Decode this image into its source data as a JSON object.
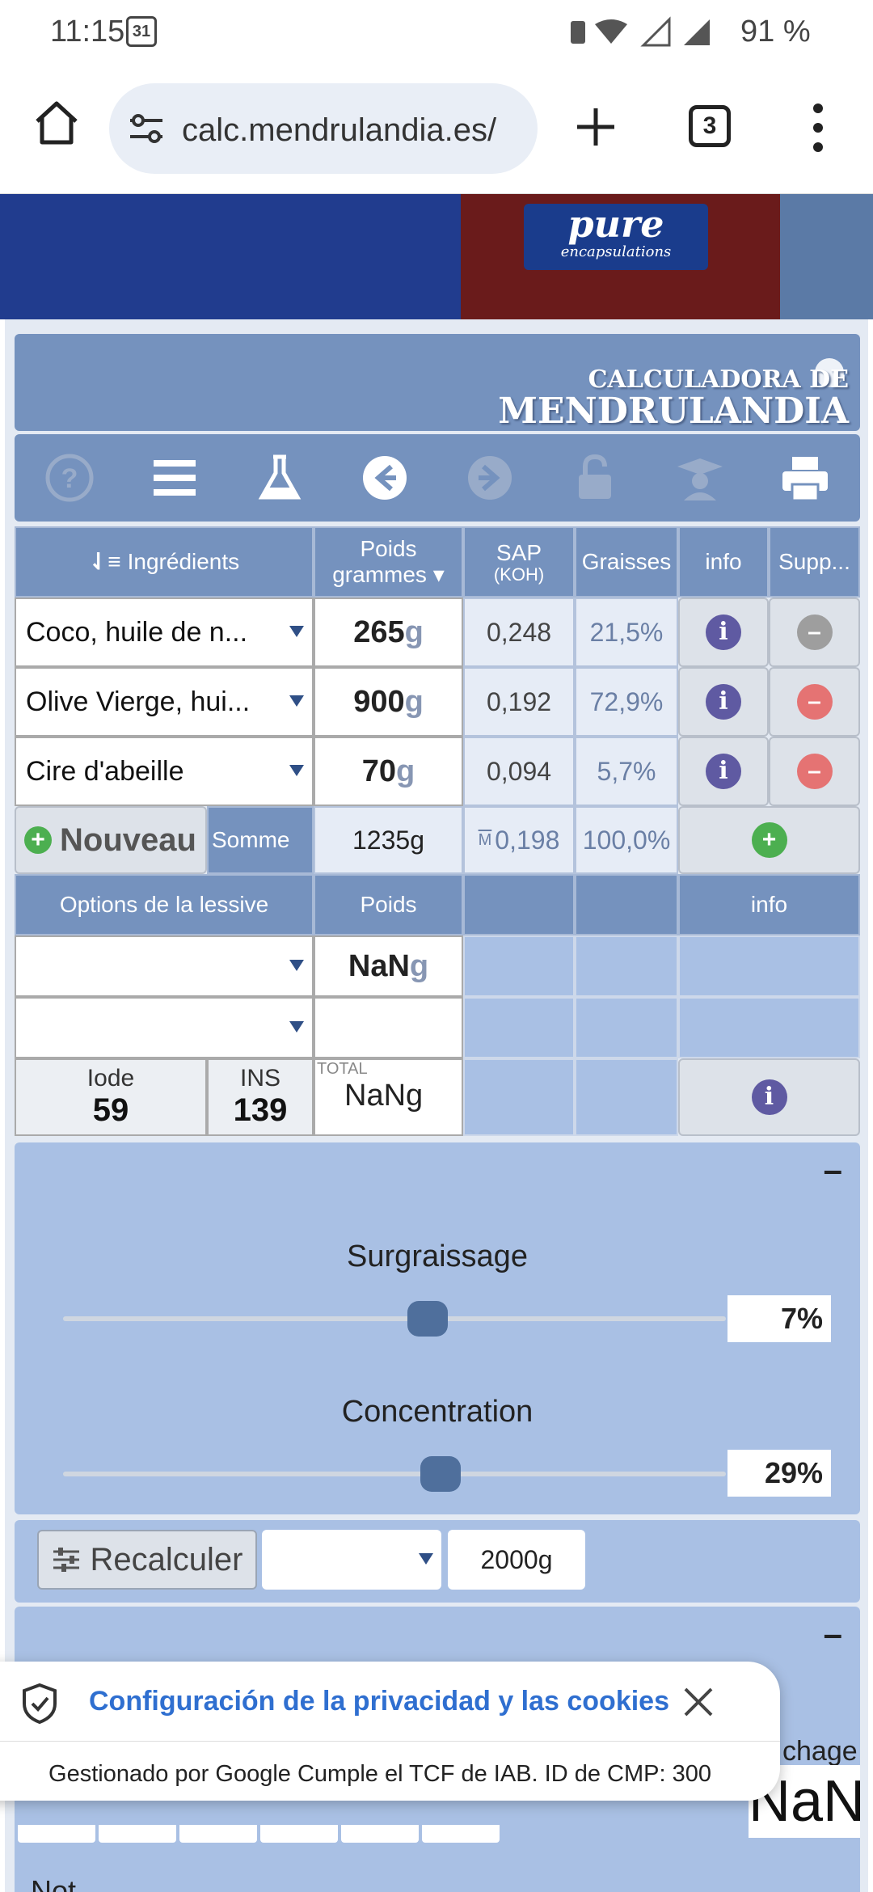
{
  "status_bar": {
    "time": "11:15",
    "calendar_day": "31",
    "battery": "91 %"
  },
  "browser": {
    "url": "calc.mendrulandia.es/",
    "tab_count": "3"
  },
  "ad": {
    "brand_top": "pure",
    "brand_sub": "encapsulations"
  },
  "header": {
    "logo_line1": "CALCULADORA DE",
    "logo_line2": "MENDRULANDIA"
  },
  "toolbar": {
    "icons": [
      "help-icon",
      "menu-icon",
      "flask-icon",
      "back-arrow-icon",
      "forward-arrow-icon",
      "unlock-icon",
      "graduate-icon",
      "print-icon"
    ]
  },
  "table": {
    "headers": {
      "ingredients": "Ingrédients",
      "weight_line1": "Poids",
      "weight_line2": "grammes ▾",
      "sap_line1": "SAP",
      "sap_line2": "(KOH)",
      "fats": "Graisses",
      "info": "info",
      "delete": "Supp..."
    },
    "rows": [
      {
        "name": "Coco, huile de n...",
        "weight": "265",
        "unit": "g",
        "sap": "0,248",
        "fat": "21,5%"
      },
      {
        "name": "Olive Vierge, hui...",
        "weight": "900",
        "unit": "g",
        "sap": "0,192",
        "fat": "72,9%"
      },
      {
        "name": "Cire d'abeille",
        "weight": "70",
        "unit": "g",
        "sap": "0,094",
        "fat": "5,7%"
      }
    ],
    "summary": {
      "new_label": "Nouveau",
      "sum_label": "Somme",
      "sum_weight": "1235g",
      "sap_prefix": "M",
      "sap_avg": "0,198",
      "fat_total": "100,0%"
    },
    "lye": {
      "options_label": "Options de la lessive",
      "weight_label": "Poids",
      "info_label": "info",
      "row1_weight": "NaN",
      "row1_unit": "g",
      "iode_label": "Iode",
      "iode_value": "59",
      "ins_label": "INS",
      "ins_value": "139",
      "total_label": "TOTAL",
      "total_value": "NaNg"
    }
  },
  "settings": {
    "collapse": "–",
    "superfat_label": "Surgraissage",
    "superfat_value": "7%",
    "superfat_level": 0.55,
    "concentration_label": "Concentration",
    "concentration_value": "29%",
    "concentration_level": 0.57
  },
  "recalc": {
    "button_label": "Recalculer",
    "amount": "2000g"
  },
  "block2": {
    "collapse": "–",
    "partial_label": "chage",
    "partial_value": "NaN"
  },
  "block3": {
    "partial_label": "Not"
  },
  "cookie": {
    "title": "Configuración de la privacidad y las cookies",
    "text": "Gestionado por Google Cumple el TCF de IAB. ID de CMP: 300"
  },
  "colors": {
    "panel_blue": "#7592be",
    "light_blue": "#a9c0e4",
    "info_purple": "#5f5aa2",
    "remove_red": "#e57373",
    "add_green": "#4caf50"
  }
}
